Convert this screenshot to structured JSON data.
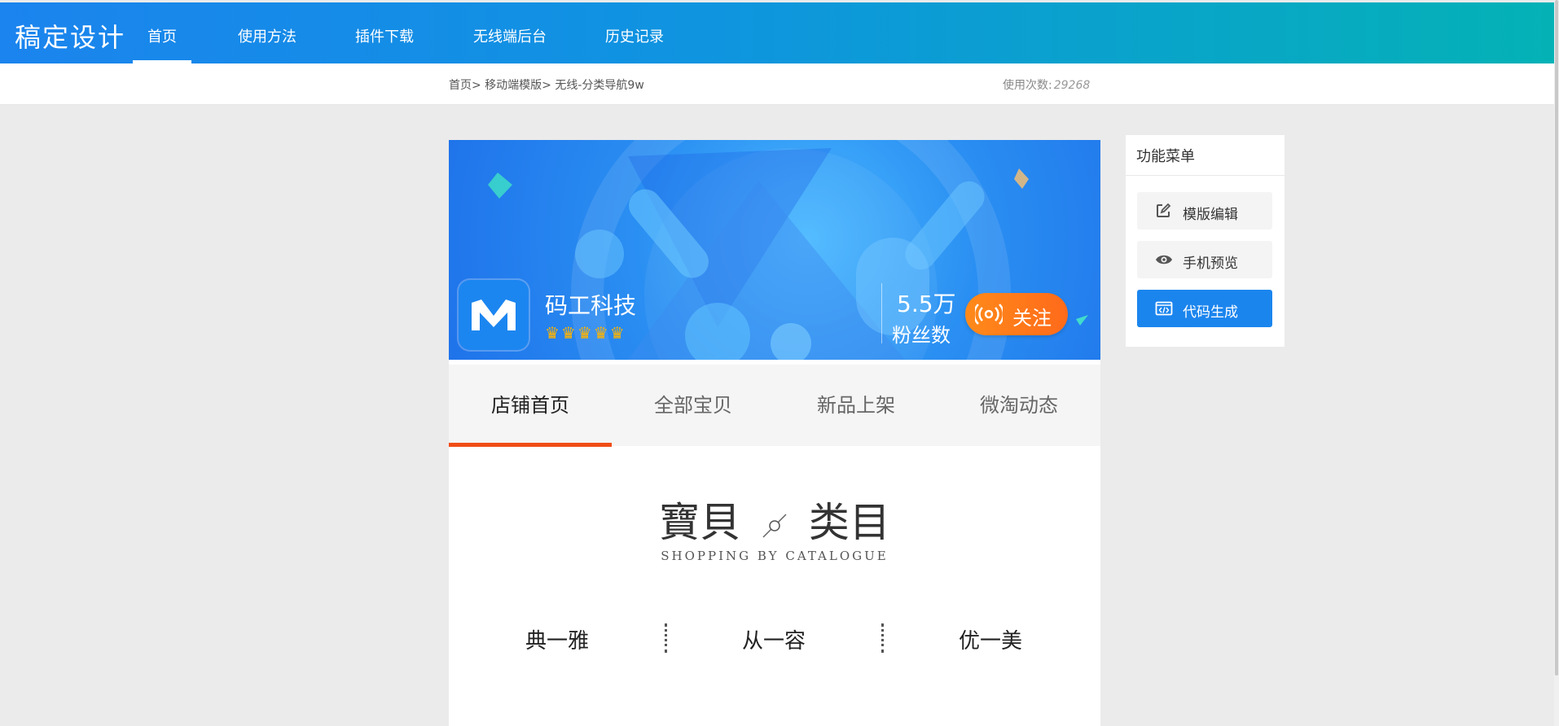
{
  "header": {
    "logo_text": "稿定设计",
    "nav": [
      "首页",
      "使用方法",
      "插件下载",
      "无线端后台",
      "历史记录"
    ],
    "active_index": 0
  },
  "subbar": {
    "breadcrumb": "首页> 移动端模版> 无线-分类导航9w",
    "usage_label": "使用次数:",
    "usage_count": "29268"
  },
  "preview": {
    "shop_name": "码工科技",
    "crowns": "♛♛♛♛♛",
    "fans_count": "5.5万",
    "fans_label": "粉丝数",
    "follow_label": "关注",
    "tabs": [
      "店铺首页",
      "全部宝贝",
      "新品上架",
      "微淘动态"
    ],
    "active_tab": 0,
    "category_title_left": "寶貝",
    "category_title_right": "类目",
    "category_subtitle": "SHOPPING BY CATALOGUE",
    "categories": [
      "典一雅",
      "从一容",
      "优一美"
    ]
  },
  "side_menu": {
    "title": "功能菜单",
    "buttons": [
      {
        "label": "模版编辑",
        "icon": "edit-icon"
      },
      {
        "label": "手机预览",
        "icon": "eye-icon"
      },
      {
        "label": "代码生成",
        "icon": "code-icon"
      }
    ]
  },
  "colors": {
    "header_gradient_start": "#1b84ee",
    "header_gradient_end": "#04b2b6",
    "accent_orange": "#f04d17",
    "primary_blue": "#1b85ee",
    "follow_orange": "#ff7a1a"
  }
}
